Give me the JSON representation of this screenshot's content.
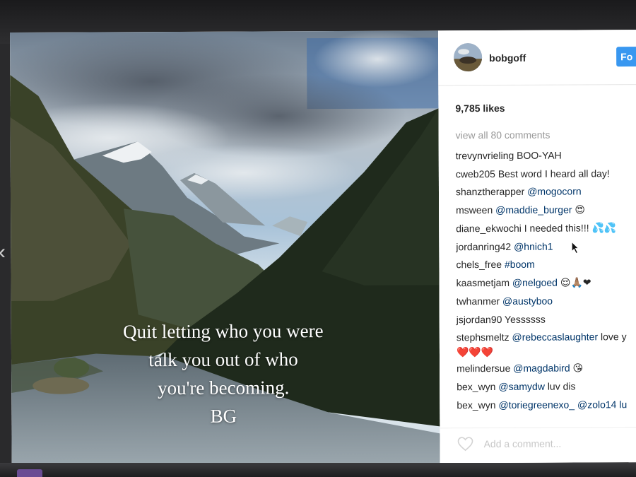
{
  "post": {
    "quote_lines": [
      "Quit letting who you were",
      "talk you out of who",
      "you're becoming.",
      "BG"
    ]
  },
  "header": {
    "username": "bobgoff",
    "follow_label": "Fo"
  },
  "likes": "9,785 likes",
  "view_all": "view all 80 comments",
  "comments": [
    {
      "user": "trevynvrieling",
      "text": "BOO-YAH",
      "mention": ""
    },
    {
      "user": "cweb205",
      "text": "Best word I heard all day!",
      "mention": ""
    },
    {
      "user": "shanztherapper",
      "text": "",
      "mention": "@mogocorn"
    },
    {
      "user": "msween",
      "text": "😍",
      "mention": "@maddie_burger"
    },
    {
      "user": "diane_ekwochi",
      "text": "I needed this!!! 💦💦",
      "mention": ""
    },
    {
      "user": "jordanring42",
      "text": "",
      "mention": "@hnich1"
    },
    {
      "user": "chels_free",
      "text": "",
      "mention": "#boom"
    },
    {
      "user": "kaasmetjam",
      "text": "😌🙏🏽❤",
      "mention": "@nelgoed"
    },
    {
      "user": "twhanmer",
      "text": "",
      "mention": "@austyboo"
    },
    {
      "user": "jsjordan90",
      "text": "Yessssss",
      "mention": ""
    },
    {
      "user": "stephsmeltz",
      "text": "love y",
      "mention": "@rebeccaslaughter",
      "second_line": "❤️❤️❤️"
    },
    {
      "user": "melindersue",
      "text": "😘",
      "mention": "@magdabird"
    },
    {
      "user": "bex_wyn",
      "text": "luv dis",
      "mention": "@samydw"
    },
    {
      "user": "bex_wyn",
      "text": "@zolo14 lu",
      "mention": "@toriegreenexo_"
    }
  ],
  "add_comment_placeholder": "Add a comment...",
  "icons": {
    "heart": "heart-outline-icon",
    "back": "chevron-left-icon"
  },
  "colors": {
    "follow_button": "#3897f0",
    "mention": "#003569",
    "muted": "#999999"
  }
}
